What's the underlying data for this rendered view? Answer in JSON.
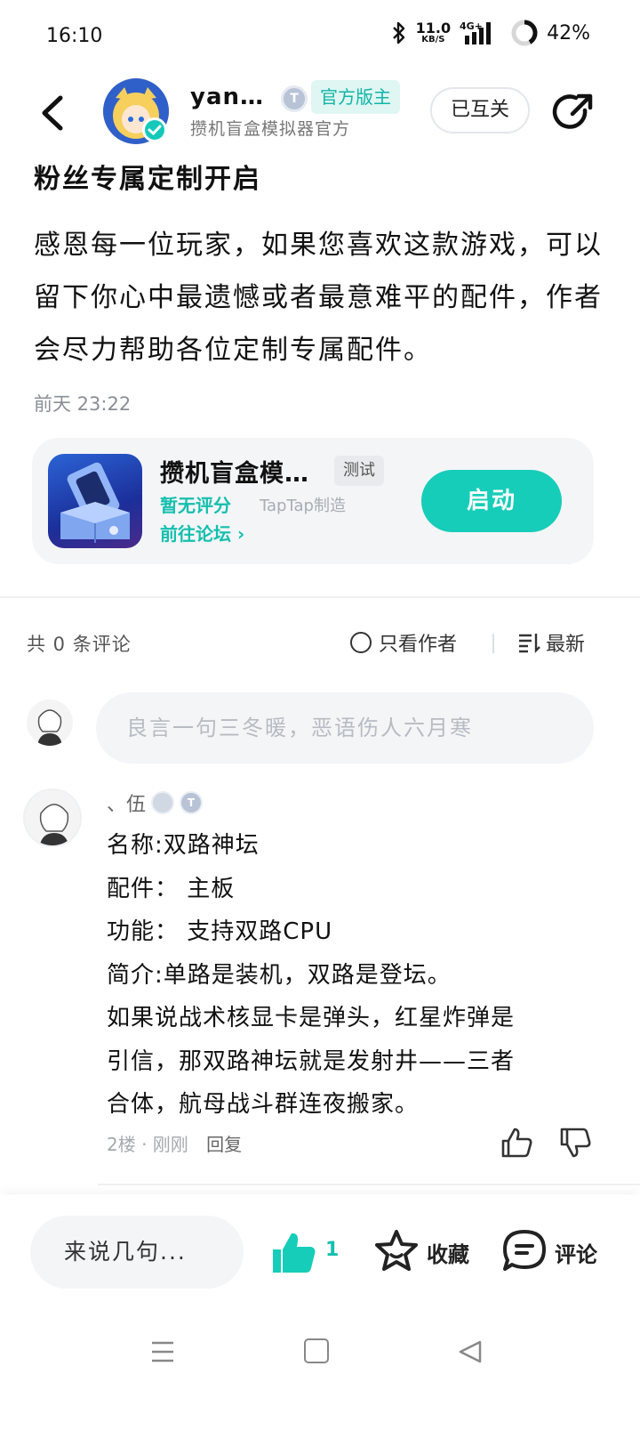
{
  "status_bar": {
    "time": "16:10",
    "net_speed": "11.0",
    "net_unit": "KB/S",
    "network": "4G+",
    "battery": "42%",
    "icons": [
      "bluetooth-icon",
      "signal-icon",
      "battery-icon"
    ]
  },
  "header": {
    "author_name": "yan…",
    "badge_letter": "T",
    "official_tag": "官方版主",
    "author_subtitle": "攒机盲盒模拟器官方",
    "follow_label": "已互关"
  },
  "post": {
    "title": "粉丝专属定制开启",
    "body": "感恩每一位玩家，如果您喜欢这款游戏，可以留下你心中最遗憾或者最意难平的配件，作者会尽力帮助各位定制专属配件。",
    "time": "前天 23:22"
  },
  "app_card": {
    "name": "攒机盲盒模…",
    "tag": "测试",
    "rating": "暂无评分",
    "maker": "TapTap制造",
    "forum_link": "前往论坛",
    "launch_label": "启动"
  },
  "comments": {
    "count_label": "共 0 条评论",
    "only_author": "只看作者",
    "sort_label": "最新",
    "input_placeholder": "良言一句三冬暖，恶语伤人六月寒",
    "items": [
      {
        "user": "、伍",
        "lines": [
          "名称:双路神坛",
          "配件： 主板",
          "功能： 支持双路CPU",
          "简介:单路是装机，双路是登坛。",
          "如果说战术核显卡是弹头，红星炸弹是",
          "引信，那双路神坛就是发射井——三者",
          "合体，航母战斗群连夜搬家。"
        ],
        "meta": "2楼 · 刚刚",
        "reply_label": "回复"
      }
    ]
  },
  "bottom_bar": {
    "say_placeholder": "来说几句...",
    "like_count": "1",
    "fav_label": "收藏",
    "comment_label": "评论"
  },
  "colors": {
    "accent": "#16cdb9",
    "text": "#111111",
    "muted": "#8a8f96",
    "card_bg": "#f4f5f7"
  }
}
